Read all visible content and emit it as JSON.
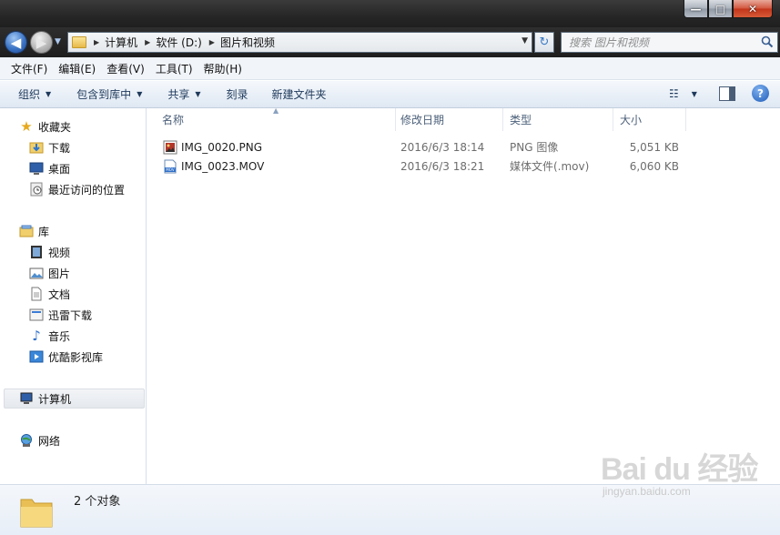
{
  "window": {
    "caption": {
      "minimize": "—",
      "maximize": "□",
      "close": "✕"
    }
  },
  "navigation": {
    "back_glyph": "◀",
    "forward_glyph": "▶",
    "history_glyph": "▼",
    "refresh_glyph": "↻",
    "breadcrumb": [
      "计算机",
      "软件 (D:)",
      "图片和视频"
    ],
    "breadcrumb_arrow": "▶",
    "address_dropdown_glyph": "▼",
    "search_placeholder": "搜索 图片和视频"
  },
  "menubar": [
    "文件(F)",
    "编辑(E)",
    "查看(V)",
    "工具(T)",
    "帮助(H)"
  ],
  "commandbar": {
    "items": [
      {
        "label": "组织",
        "dropdown": true
      },
      {
        "label": "包含到库中",
        "dropdown": true
      },
      {
        "label": "共享",
        "dropdown": true
      },
      {
        "label": "刻录",
        "dropdown": false
      },
      {
        "label": "新建文件夹",
        "dropdown": false
      }
    ],
    "dropdown_glyph": "▼",
    "view_icon_glyph": "☷",
    "help_glyph": "?"
  },
  "sidebar": {
    "favorites": {
      "label": "收藏夹",
      "items": [
        "下载",
        "桌面",
        "最近访问的位置"
      ]
    },
    "libraries": {
      "label": "库",
      "items": [
        "视频",
        "图片",
        "文档",
        "迅雷下载",
        "音乐",
        "优酷影视库"
      ]
    },
    "computer": "计算机",
    "network": "网络"
  },
  "file_list": {
    "columns": {
      "name": "名称",
      "modified": "修改日期",
      "type": "类型",
      "size": "大小"
    },
    "sort_glyph": "▲",
    "files": [
      {
        "name": "IMG_0020.PNG",
        "modified": "2016/6/3 18:14",
        "type": "PNG 图像",
        "size": "5,051 KB",
        "icon": "png-image-icon"
      },
      {
        "name": "IMG_0023.MOV",
        "modified": "2016/6/3 18:21",
        "type": "媒体文件(.mov)",
        "size": "6,060 KB",
        "icon": "mov-video-icon"
      }
    ]
  },
  "status": {
    "text": "2 个对象"
  },
  "watermark": {
    "logo": "Bai du 经验",
    "url": "jingyan.baidu.com"
  },
  "colors": {
    "title_bar": "#262626",
    "command_bar": "#dfe8f3",
    "link_text": "#1e395b",
    "header_text": "#4c607a",
    "folder_yellow": "#e7b949"
  }
}
